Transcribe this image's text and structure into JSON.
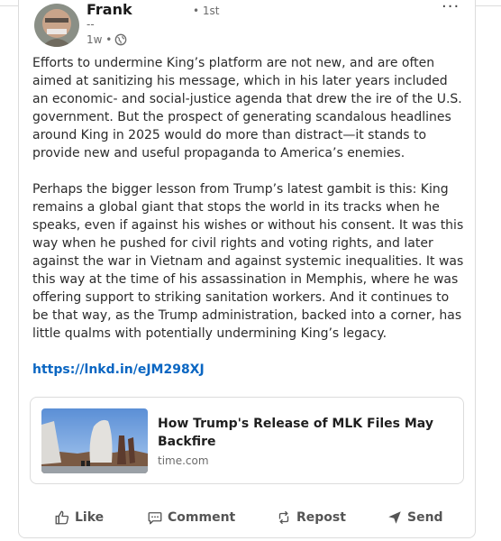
{
  "post": {
    "author_name": "Frank",
    "degree": "• 1st",
    "headline": "--",
    "time": "1w •",
    "more_label": "···",
    "paragraphs": [
      "Efforts to undermine King’s platform are not new, and are often aimed at sanitizing his message, which in his later years included an economic- and social-justice agenda that drew the ire of the U.S. government. But the prospect of generating scandalous headlines around King in 2025 would do more than distract—it stands to provide new and useful propaganda to America’s enemies.",
      "Perhaps the bigger lesson from Trump’s latest gambit is this: King remains a global giant that stops the world in its tracks when he speaks, even if against his wishes or without his consent. It was this way when he pushed for civil rights and voting rights, and later against the war in Vietnam and against systemic inequalities. It was this way at the time of his assassination in Memphis, where he was offering support to striking sanitation workers. And it continues to be that way, as the Trump administration, backed into a corner, has little qualms with potentially undermining King’s legacy."
    ],
    "link": "https://lnkd.in/eJM298XJ"
  },
  "preview": {
    "title": "How Trump's Release of MLK Files May Backfire",
    "domain": "time.com"
  },
  "actions": {
    "like": "Like",
    "comment": "Comment",
    "repost": "Repost",
    "send": "Send"
  },
  "colors": {
    "link": "#0a66c2",
    "muted": "#6b6b6b",
    "border": "#dcdcdc"
  }
}
